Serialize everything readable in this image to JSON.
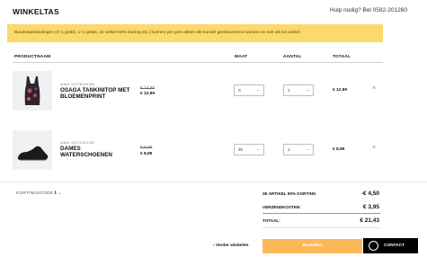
{
  "header": {
    "title": "WINKELTAS",
    "help": "Hulp nodig? Bel 0592-201260"
  },
  "banner": {
    "text": "Bundelaanbiedingen (2+1 gratis, 1+1 gratis, 2e artikel 50% korting etc.) kunnen per post alleen als bundel geretourneerd worden en niet als los artikel."
  },
  "table_headers": {
    "product": "PRODUCTNAAM",
    "size": "MAAT",
    "qty": "AANTAL",
    "total": "TOTAAL"
  },
  "items": [
    {
      "article": "Artikel: 1107161021068",
      "name": "OSAGA TANKINITOP MET BLOEMENPRINT",
      "old_price": "€ 14,99",
      "new_price": "€ 12,99",
      "size": "S",
      "qty": "1",
      "total": "€ 12,99",
      "remove": "×"
    },
    {
      "article": "Artikel: 1101713121350",
      "name": "DAMES WATERSCHOENEN",
      "old_price": "€ 9,99",
      "new_price": "€ 8,99",
      "size": "39",
      "qty": "1",
      "total": "€ 8,99",
      "remove": "×"
    }
  ],
  "discount": {
    "label": "KORTINGSCODE",
    "info": "ℹ",
    "chevron": "⌄"
  },
  "summary": [
    {
      "label": "2E ARTIKEL 50% KORTING",
      "value": "-€ 4,50"
    },
    {
      "label": "VERZENDKOSTEN:",
      "value": "€ 3,95"
    },
    {
      "label": "TOTAAL:",
      "value": "€ 21,43"
    }
  ],
  "actions": {
    "back": "‹ Verder winkelen",
    "checkout": "Bestellen",
    "contact": "CONTACT"
  },
  "icons": {
    "chevron": "chevron-down-icon",
    "remove": "close-icon",
    "contact": "chat-icon"
  },
  "colors": {
    "banner": "#fbd96a",
    "checkout": "#fcb95a",
    "contact": "#000000"
  }
}
